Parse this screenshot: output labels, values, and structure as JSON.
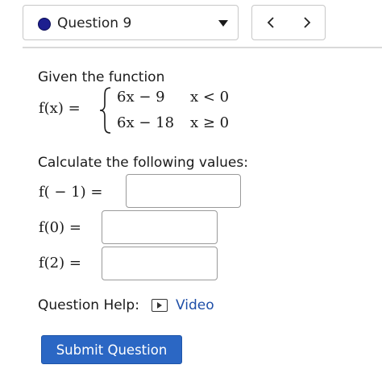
{
  "question_selector": {
    "label": "Question 9",
    "status_color": "#1d1f8f",
    "icons": {
      "status": "filled-dot-icon",
      "dropdown": "caret-down-icon"
    }
  },
  "nav": {
    "prev_label": "<",
    "next_label": ">",
    "icons": {
      "prev": "chevron-left-icon",
      "next": "chevron-right-icon"
    }
  },
  "problem": {
    "intro": "Given the function",
    "lhs": "f(x) =",
    "cases": [
      {
        "expr": "6x − 9",
        "cond": "x < 0"
      },
      {
        "expr": "6x − 18",
        "cond": "x ≥ 0"
      }
    ],
    "instruction": "Calculate the following values:"
  },
  "answers": [
    {
      "label": "f( − 1) =",
      "value": ""
    },
    {
      "label": "f(0) =",
      "value": ""
    },
    {
      "label": "f(2) =",
      "value": ""
    }
  ],
  "help": {
    "label": "Question Help:",
    "link_label": "Video",
    "link_color": "#1f4fa8",
    "icon": "video-play-icon"
  },
  "submit": {
    "label": "Submit Question",
    "color": "#2b67c4"
  }
}
